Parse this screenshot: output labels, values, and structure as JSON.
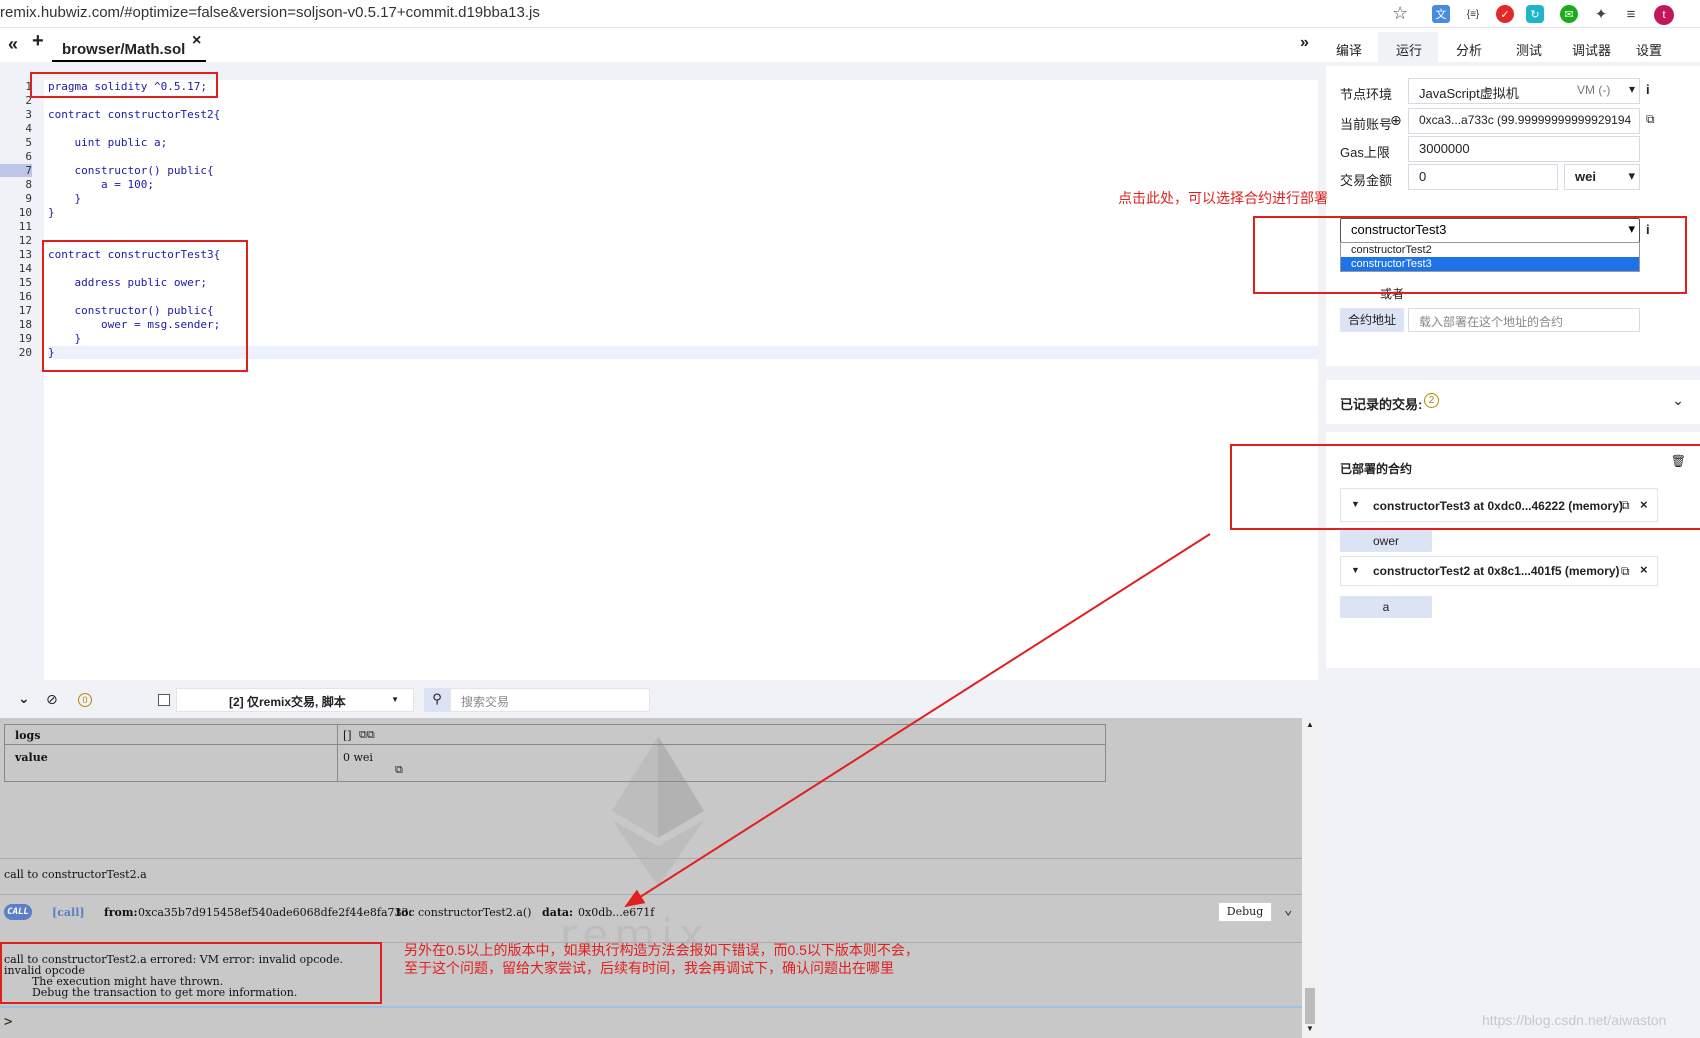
{
  "browser": {
    "url": "remix.hubwiz.com/#optimize=false&version=soljson-v0.5.17+commit.d19bba13.js",
    "extensions": [
      "translate-icon",
      "json-icon",
      "adblock-icon",
      "sync-icon",
      "wechat-icon",
      "puzzle-icon",
      "menu-icon",
      "profile-avatar"
    ],
    "avatar_letter": "t"
  },
  "tabs": {
    "collapse": "«",
    "add": "+",
    "file": "browser/Math.sol",
    "close": "×",
    "expand": "»"
  },
  "menu": [
    "编译",
    "运行",
    "分析",
    "测试",
    "调试器",
    "设置"
  ],
  "menu_active": "运行",
  "editor": {
    "lines": [
      {
        "n": "1",
        "code": "pragma solidity ^0.5.17;"
      },
      {
        "n": "2",
        "code": ""
      },
      {
        "n": "3",
        "code": "contract constructorTest2{"
      },
      {
        "n": "4",
        "code": ""
      },
      {
        "n": "5",
        "code": "    uint public a;"
      },
      {
        "n": "6",
        "code": ""
      },
      {
        "n": "7",
        "code": "    constructor() public{"
      },
      {
        "n": "8",
        "code": "        a = 100;"
      },
      {
        "n": "9",
        "code": "    }"
      },
      {
        "n": "10",
        "code": "}"
      },
      {
        "n": "11",
        "code": ""
      },
      {
        "n": "12",
        "code": ""
      },
      {
        "n": "13",
        "code": "contract constructorTest3{"
      },
      {
        "n": "14",
        "code": ""
      },
      {
        "n": "15",
        "code": "    address public ower;"
      },
      {
        "n": "16",
        "code": ""
      },
      {
        "n": "17",
        "code": "    constructor() public{"
      },
      {
        "n": "18",
        "code": "        ower = msg.sender;"
      },
      {
        "n": "19",
        "code": "    }"
      },
      {
        "n": "20",
        "code": "}"
      }
    ]
  },
  "run": {
    "env_label": "节点环境",
    "env_value": "JavaScript虚拟机",
    "env_vm": "VM (-)",
    "account_label": "当前账号",
    "account_value": "0xca3...a733c (99.99999999999929194",
    "gas_label": "Gas上限",
    "gas_value": "3000000",
    "value_label": "交易金额",
    "value_value": "0",
    "value_unit": "wei",
    "contract_selected": "constructorTest3",
    "contract_options": [
      "constructorTest2",
      "constructorTest3"
    ],
    "or_label": "或者",
    "at_address_button": "合约地址",
    "at_address_placeholder": "载入部署在这个地址的合约",
    "recorded_label": "已记录的交易:",
    "recorded_count": "2",
    "deployed_label": "已部署的合约",
    "instances": [
      {
        "title": "constructorTest3 at 0xdc0...46222 (memory)",
        "fn": "ower"
      },
      {
        "title": "constructorTest2 at 0x8c1...401f5 (memory)",
        "fn": "a"
      }
    ]
  },
  "terminal": {
    "count": "0",
    "filter": "[2] 仅remix交易, 脚本",
    "search_placeholder": "搜索交易",
    "logs_key": "logs",
    "logs_val": "[]",
    "value_key": "value",
    "value_val": "0 wei",
    "call_line": "call to constructorTest2.a",
    "call_badge": "CALL",
    "call_tag": "[call]",
    "from_label": "from:",
    "from_val": "0xca35b7d915458ef540ade6068dfe2f44e8fa733c",
    "to_label": "to:",
    "to_val": "constructorTest2.a()",
    "data_label": "data:",
    "data_val": "0x0db...e671f",
    "debug_button": "Debug",
    "error_lines": [
      "call to constructorTest2.a errored: VM error: invalid opcode.",
      "invalid opcode",
      "        The execution might have thrown.",
      "        Debug the transaction to get more information."
    ],
    "prompt": ">",
    "watermark": "remix"
  },
  "annotations": {
    "select_hint": "点击此处，可以选择合约进行部署",
    "note_line1": "另外在0.5以上的版本中，如果执行构造方法会报如下错误，而0.5以下版本则不会，",
    "note_line2": "至于这个问题，留给大家尝试，后续有时间，我会再调试下，确认问题出在哪里"
  },
  "footer_watermark": "https://blog.csdn.net/aiwaston"
}
